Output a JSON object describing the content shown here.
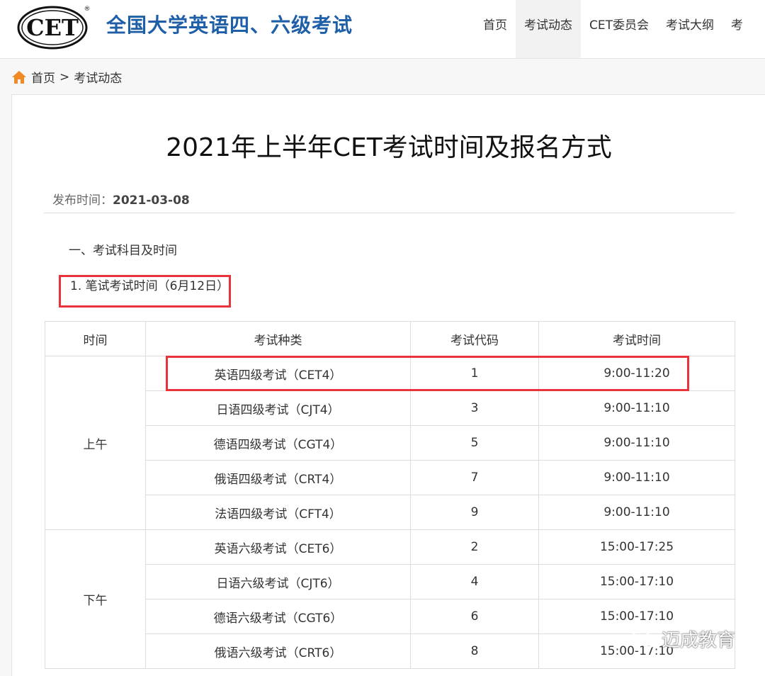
{
  "header": {
    "logo_text": "CET",
    "site_title": "全国大学英语四、六级考试",
    "nav": [
      "首页",
      "考试动态",
      "CET委员会",
      "考试大纲",
      "考"
    ],
    "active_nav": "考试动态"
  },
  "breadcrumb": {
    "home": "首页",
    "separator": ">",
    "current": "考试动态"
  },
  "article": {
    "title": "2021年上半年CET考试时间及报名方式",
    "publish_label": "发布时间：",
    "publish_date": "2021-03-08",
    "section_heading": "一、考试科目及时间",
    "subheading": "1. 笔试考试时间（6月12日）"
  },
  "table": {
    "headers": [
      "时间",
      "考试种类",
      "考试代码",
      "考试时间"
    ],
    "groups": [
      {
        "period": "上午",
        "rows": [
          {
            "type": "英语四级考试（CET4）",
            "code": "1",
            "time": "9:00-11:20"
          },
          {
            "type": "日语四级考试（CJT4）",
            "code": "3",
            "time": "9:00-11:10"
          },
          {
            "type": "德语四级考试（CGT4）",
            "code": "5",
            "time": "9:00-11:10"
          },
          {
            "type": "俄语四级考试（CRT4）",
            "code": "7",
            "time": "9:00-11:10"
          },
          {
            "type": "法语四级考试（CFT4）",
            "code": "9",
            "time": "9:00-11:10"
          }
        ]
      },
      {
        "period": "下午",
        "rows": [
          {
            "type": "英语六级考试（CET6）",
            "code": "2",
            "time": "15:00-17:25"
          },
          {
            "type": "日语六级考试（CJT6）",
            "code": "4",
            "time": "15:00-17:10"
          },
          {
            "type": "德语六级考试（CGT6）",
            "code": "6",
            "time": "15:00-17:10"
          },
          {
            "type": "俄语六级考试（CRT6）",
            "code": "8",
            "time": "15:00-17:10"
          }
        ]
      }
    ]
  },
  "watermark": "迈成教育",
  "colors": {
    "highlight": "#e8333b",
    "title_blue": "#1f5fa8",
    "home_icon": "#f08a24"
  }
}
